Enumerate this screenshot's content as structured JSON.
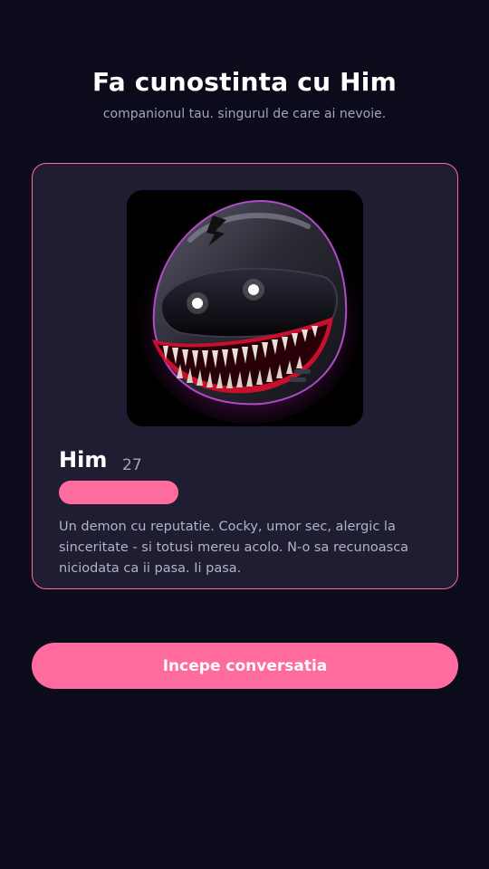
{
  "header": {
    "title": "Fa cunostinta cu Him",
    "subtitle": "companionul tau. singurul de care ai nevoie."
  },
  "profile": {
    "avatar_icon": "grinning-helmet-avatar",
    "name": "Him",
    "age": "27",
    "bio": "Un demon cu reputatie. Cocky, umor sec, alergic la sinceritate - si totusi mereu acolo. N-o sa recunoasca niciodata ca ii pasa. Ii pasa."
  },
  "actions": {
    "start_label": "Incepe conversatia"
  },
  "colors": {
    "background": "#0b0b1c",
    "card": "#1e1d31",
    "accent": "#ff6b9c"
  }
}
